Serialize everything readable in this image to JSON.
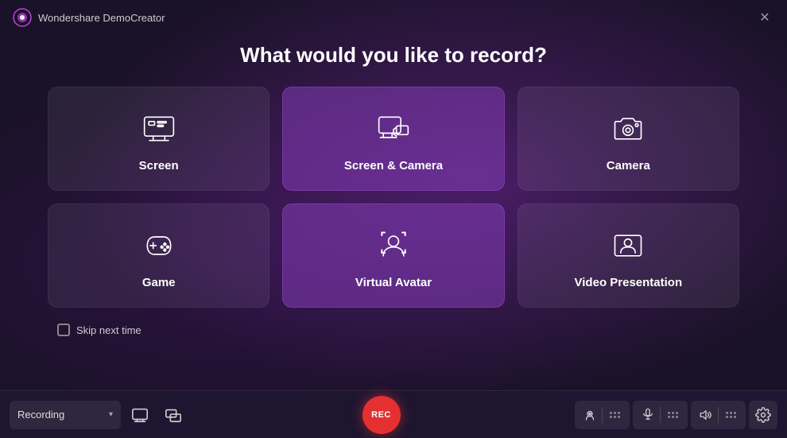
{
  "app": {
    "title": "Wondershare DemoCreator",
    "logo_color": "#c040e0"
  },
  "page": {
    "heading": "What would you like to record?"
  },
  "cards": [
    {
      "id": "screen",
      "label": "Screen",
      "icon": "screen",
      "highlighted": false
    },
    {
      "id": "screen-camera",
      "label": "Screen & Camera",
      "icon": "screen-camera",
      "highlighted": true
    },
    {
      "id": "camera",
      "label": "Camera",
      "icon": "camera",
      "highlighted": false
    },
    {
      "id": "game",
      "label": "Game",
      "icon": "game",
      "highlighted": false
    },
    {
      "id": "virtual-avatar",
      "label": "Virtual Avatar",
      "icon": "avatar",
      "highlighted": true
    },
    {
      "id": "video-presentation",
      "label": "Video Presentation",
      "icon": "presentation",
      "highlighted": false
    }
  ],
  "skip": {
    "label": "Skip next time"
  },
  "toolbar": {
    "recording_label": "Recording",
    "recording_chevron": "▾",
    "rec_label": "REC"
  }
}
